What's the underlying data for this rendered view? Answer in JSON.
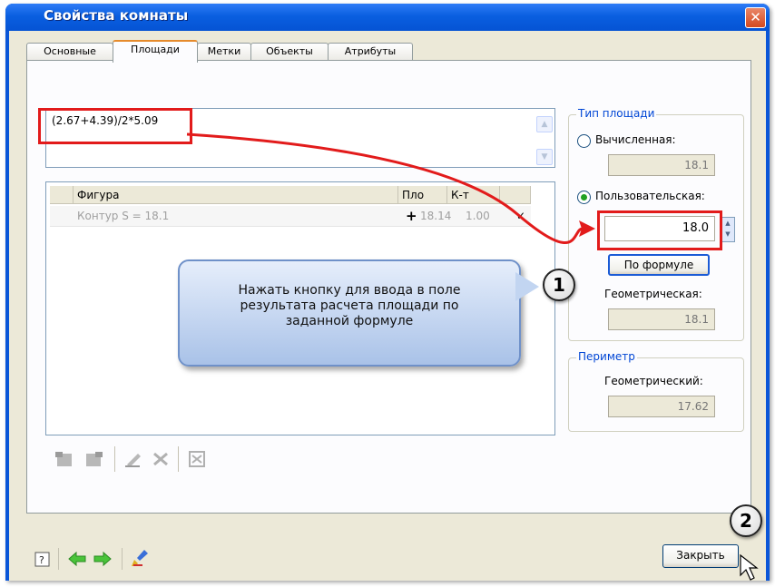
{
  "window": {
    "title": "Свойства комнаты",
    "close_glyph": "✕"
  },
  "tabs": [
    "Основные",
    "Площади",
    "Метки",
    "Объекты",
    "Атрибуты"
  ],
  "formula": {
    "value": "(2.67+4.39)/2*5.09"
  },
  "figures_table": {
    "headers": [
      "Фигура",
      "Пло",
      "К-т"
    ],
    "rows": [
      {
        "figure": "Контур S = 18.1",
        "action": "+",
        "area": "18.14",
        "coef": "1.00",
        "check": "✓"
      }
    ]
  },
  "area_type": {
    "title": "Тип площади",
    "calculated_label": "Вычисленная:",
    "calculated_value": "18.1",
    "user_label": "Пользовательская:",
    "user_value": "18.0",
    "formula_button": "По формуле",
    "geometric_label": "Геометрическая:",
    "geometric_value": "18.1",
    "selected": "user"
  },
  "perimeter": {
    "title": "Периметр",
    "geometric_label": "Геометрический:",
    "geometric_value": "17.62"
  },
  "callout": {
    "line1": "Нажать кнопку для ввода в поле",
    "line2": "результата расчета площади по",
    "line3": "заданной формуле"
  },
  "badges": [
    "1",
    "2"
  ],
  "footer": {
    "close_button": "Закрыть"
  },
  "icons": [
    "add-figure-icon",
    "remove-figure-icon",
    "edit-icon",
    "delete-icon",
    "calculator-icon",
    "help-icon",
    "back-arrow-icon",
    "forward-arrow-icon",
    "brush-icon",
    "scroll-up-icon",
    "scroll-down-icon",
    "spinner-icon",
    "mouse-cursor-icon"
  ],
  "colors": {
    "titlebar": "#0a56d8",
    "highlight": "#e21b1b",
    "groupbox_title": "#0046d5",
    "callout": "#a9c2e8"
  }
}
